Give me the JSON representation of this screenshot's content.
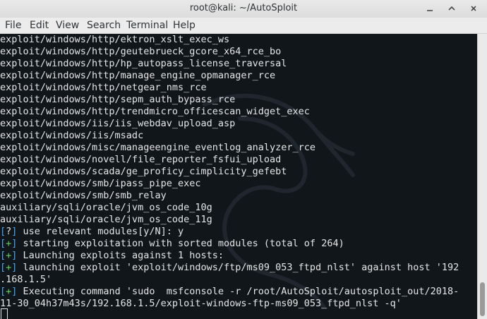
{
  "window": {
    "title": "root@kali: ~/AutoSploit"
  },
  "menu": [
    "File",
    "Edit",
    "View",
    "Search",
    "Terminal",
    "Help"
  ],
  "terminal": {
    "lines": [
      "exploit/windows/http/ektron_xslt_exec_ws",
      "exploit/windows/http/geutebrueck_gcore_x64_rce_bo",
      "exploit/windows/http/hp_autopass_license_traversal",
      "exploit/windows/http/manage_engine_opmanager_rce",
      "exploit/windows/http/netgear_nms_rce",
      "exploit/windows/http/sepm_auth_bypass_rce",
      "exploit/windows/http/trendmicro_officescan_widget_exec",
      "exploit/windows/iis/iis_webdav_upload_asp",
      "exploit/windows/iis/msadc",
      "exploit/windows/misc/manageengine_eventlog_analyzer_rce",
      "exploit/windows/novell/file_reporter_fsfui_upload",
      "exploit/windows/scada/ge_proficy_cimplicity_gefebt",
      "exploit/windows/smb/ipass_pipe_exec",
      "exploit/windows/smb/smb_relay",
      "auxiliary/sqli/oracle/jvm_os_code_10g",
      "auxiliary/sqli/oracle/jvm_os_code_11g"
    ],
    "messages": [
      {
        "symbol": "?",
        "text": " use relevant modules[y/N]: y"
      },
      {
        "symbol": "+",
        "text": " starting exploitation with sorted modules (total of 264)"
      },
      {
        "symbol": "+",
        "text": " Launching exploits against 1 hosts:"
      },
      {
        "symbol": "+",
        "text": " launching exploit 'exploit/windows/ftp/ms09_053_ftpd_nlst' against host '192"
      }
    ],
    "wrap_line_1": ".168.1.5'",
    "exec_message": {
      "symbol": "+",
      "text": " Executing command 'sudo  msfconsole -r /root/AutoSploit/autosploit_out/2018-"
    },
    "wrap_line_2": "11-30_04h37m43s/192.168.1.5/exploit-windows-ftp-ms09_053_ftpd_nlst -q'"
  },
  "colors": {
    "background": "#11161b",
    "text": "#e6e6e6",
    "bracket": "#4aa5f0",
    "plus": "#60d060"
  }
}
